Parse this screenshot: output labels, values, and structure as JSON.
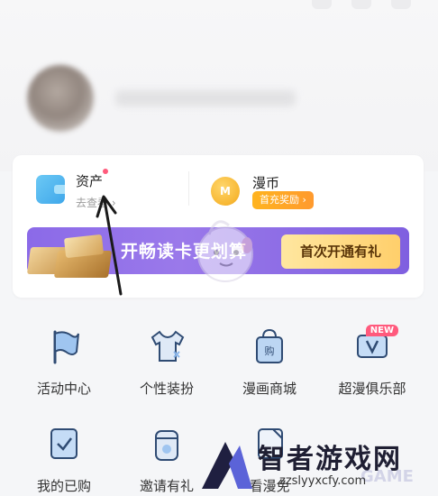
{
  "asset": {
    "title": "资产",
    "link": "去查看 ›"
  },
  "coin": {
    "title": "漫币",
    "icon_letter": "M",
    "badge": "首充奖励 ›"
  },
  "vip_banner": {
    "text": "开畅读卡更划算",
    "button": "首次开通有礼"
  },
  "menu": [
    {
      "label": "活动中心",
      "icon": "flag-icon"
    },
    {
      "label": "个性装扮",
      "icon": "tshirt-icon"
    },
    {
      "label": "漫画商城",
      "icon": "shopping-bag-icon"
    },
    {
      "label": "超漫俱乐部",
      "icon": "vip-card-icon",
      "badge": "NEW"
    },
    {
      "label": "我的已购",
      "icon": "purchased-book-icon"
    },
    {
      "label": "邀请有礼",
      "icon": "gift-jar-icon"
    },
    {
      "label": "看漫免",
      "icon": "free-read-icon"
    }
  ],
  "watermark": {
    "title": "智者游戏网",
    "url": "zzslyyxcfy.com",
    "game": "GAME"
  },
  "colors": {
    "accent_purple": "#8b6ae8",
    "badge_orange": "#ffa726",
    "new_badge": "#ff5a7d",
    "icon_blue": "#4aa8e8"
  }
}
